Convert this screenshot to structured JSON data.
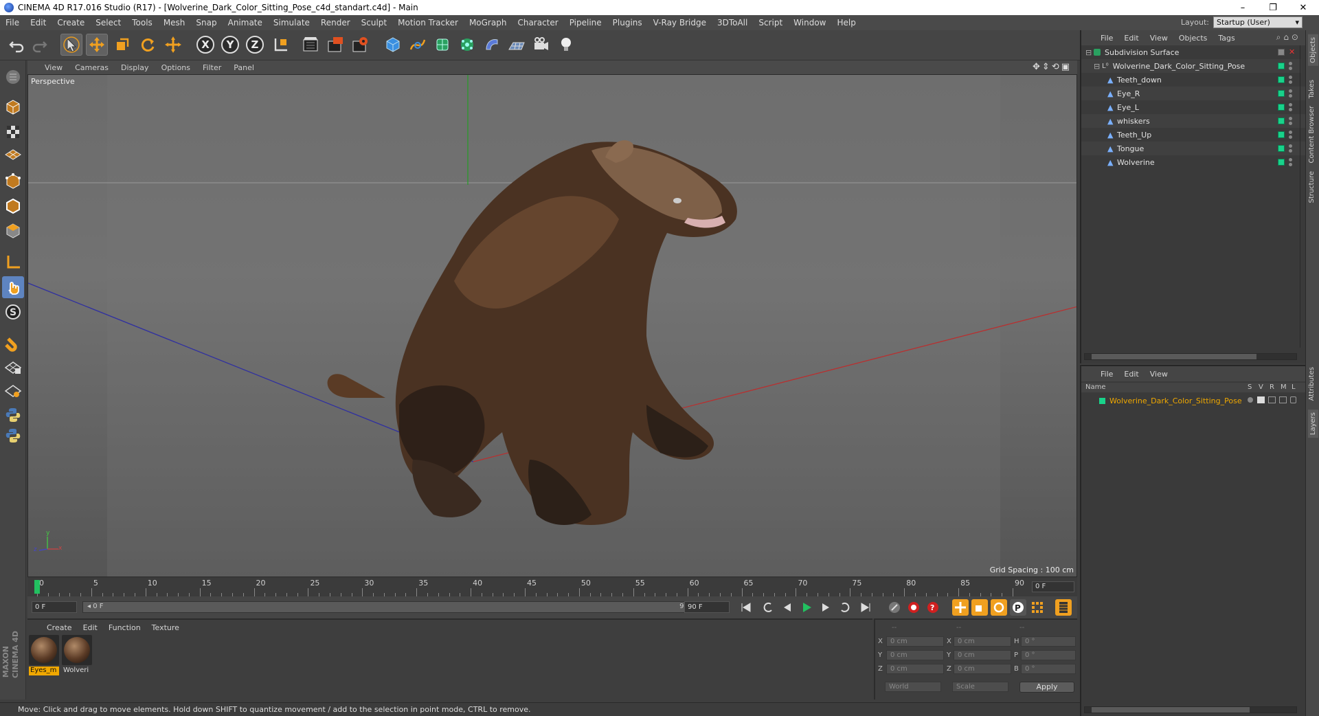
{
  "window": {
    "title": "CINEMA 4D R17.016 Studio (R17) - [Wolverine_Dark_Color_Sitting_Pose_c4d_standart.c4d] - Main",
    "minimize": "–",
    "restore": "❐",
    "close": "✕"
  },
  "menubar": {
    "items": [
      "File",
      "Edit",
      "Create",
      "Select",
      "Tools",
      "Mesh",
      "Snap",
      "Animate",
      "Simulate",
      "Render",
      "Sculpt",
      "Motion Tracker",
      "MoGraph",
      "Character",
      "Pipeline",
      "Plugins",
      "V-Ray Bridge",
      "3DToAll",
      "Script",
      "Window",
      "Help"
    ],
    "layout_label": "Layout:",
    "layout_value": "Startup (User)"
  },
  "toolbar": {
    "axis_x": "X",
    "axis_y": "Y",
    "axis_z": "Z"
  },
  "viewport": {
    "menu": [
      "View",
      "Cameras",
      "Display",
      "Options",
      "Filter",
      "Panel"
    ],
    "label": "Perspective",
    "grid_spacing": "Grid Spacing : 100 cm",
    "axis_x": "x",
    "axis_y": "y",
    "axis_z": "z"
  },
  "timeline": {
    "ticks": [
      "0",
      "5",
      "10",
      "15",
      "20",
      "25",
      "30",
      "35",
      "40",
      "45",
      "50",
      "55",
      "60",
      "65",
      "70",
      "75",
      "80",
      "85",
      "90"
    ],
    "current_frame": "0 F",
    "start_field": "0 F",
    "range_start": "◂ 0 F",
    "range_end": "90 F ▸",
    "end_field": "90 F",
    "end_value": 90
  },
  "materials": {
    "menu": [
      "Create",
      "Edit",
      "Function",
      "Texture"
    ],
    "items": [
      {
        "label": "Eyes_m",
        "selected": true
      },
      {
        "label": "Wolveri",
        "selected": false
      }
    ],
    "brand_top": "MAXON",
    "brand_bottom": "CINEMA 4D"
  },
  "coordinates": {
    "header": [
      "--",
      "--",
      "--"
    ],
    "rows": [
      {
        "a_label": "X",
        "a_val": "0 cm",
        "b_label": "X",
        "b_val": "0 cm",
        "c_label": "H",
        "c_val": "0 °"
      },
      {
        "a_label": "Y",
        "a_val": "0 cm",
        "b_label": "Y",
        "b_val": "0 cm",
        "c_label": "P",
        "c_val": "0 °"
      },
      {
        "a_label": "Z",
        "a_val": "0 cm",
        "b_label": "Z",
        "b_val": "0 cm",
        "c_label": "B",
        "c_val": "0 °"
      }
    ],
    "mode": "World",
    "scale": "Scale",
    "apply": "Apply"
  },
  "status": {
    "text": "Move: Click and drag to move elements. Hold down SHIFT to quantize movement / add to the selection in point mode, CTRL to remove."
  },
  "object_manager": {
    "menu": [
      "File",
      "Edit",
      "View",
      "Objects",
      "Tags"
    ],
    "root": "Subdivision Surface",
    "group": "Wolverine_Dark_Color_Sitting_Pose",
    "children": [
      "Teeth_down",
      "Eye_R",
      "Eye_L",
      "whiskers",
      "Teeth_Up",
      "Tongue",
      "Wolverine"
    ]
  },
  "layer_manager": {
    "menu": [
      "File",
      "Edit",
      "View"
    ],
    "col_name": "Name",
    "cols": [
      "S",
      "V",
      "R",
      "M",
      "L"
    ],
    "layer": "Wolverine_Dark_Color_Sitting_Pose",
    "layer_color": "#f0a800"
  },
  "side_tabs": [
    "Objects",
    "Takes",
    "Content Browser",
    "Structure",
    "Attributes",
    "Layers"
  ]
}
